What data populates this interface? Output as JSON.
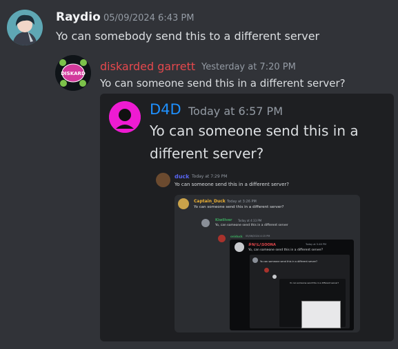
{
  "colors": {
    "background": "#313338",
    "embed_bg": "#1e1f22",
    "raydio_name": "#f2f3f5",
    "garrett_name": "#e5484d",
    "d4d_name": "#1e90ff",
    "timestamp": "#949ba4",
    "duck_name": "#5865f2",
    "captain_duck_name": "#f0b232"
  },
  "messages": [
    {
      "author": "Raydio",
      "timestamp": "05/09/2024 6:43 PM",
      "text": "Yo can somebody send this to a different server",
      "avatar_icon": "anime-character-avatar"
    },
    {
      "author": "diskarded garrett",
      "timestamp": "Yesterday at 7:20 PM",
      "text": "Yo can someone send this in a different server?",
      "avatar_icon": "diskarded-logo-avatar",
      "avatar_text": "DISKARD"
    }
  ],
  "embed": {
    "author": "D4D",
    "timestamp": "Today at 6:57 PM",
    "text_line1": "Yo can someone send this in a",
    "text_line2": "different server?",
    "avatar_icon": "d4d-avatar",
    "nested": {
      "author": "duck",
      "timestamp": "Today at 7:29 PM",
      "text": "Yo can someone send this in a different server?",
      "nested": {
        "author": "Captain_Duck",
        "timestamp": "Today at 3:26 PM",
        "text": "Yo can someone send this in a different server?",
        "nested": {
          "author": "Kiwiliver",
          "timestamp": "Today at 4:33 PM",
          "text": "Yo, can someone send this in a different server",
          "nested": {
            "author": "oniduck",
            "timestamp": "05/06/2024 4:15 PM",
            "nested": {
              "author": "乡N/\\L/\\SOONA",
              "timestamp": "Today at 5:46 PM",
              "text": "Yo, can someone send this in a different server?",
              "nested": {
                "text": "Yo can someone send this in a different server?",
                "inner_text": "Yo can someone send this in a different server?"
              }
            }
          }
        }
      }
    }
  }
}
